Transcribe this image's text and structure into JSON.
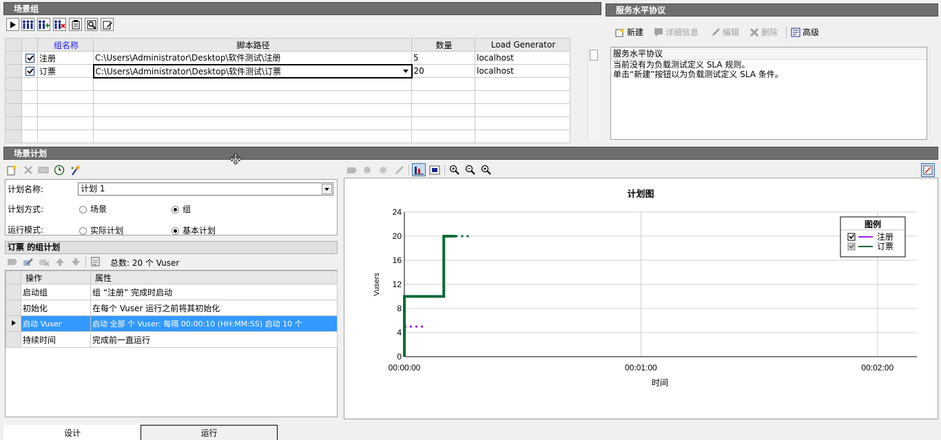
{
  "scenario_group": {
    "title": "场景组",
    "columns": [
      "组名称",
      "脚本路径",
      "数量",
      "Load Generator"
    ],
    "rows": [
      {
        "name": "注册",
        "path": "C:\\Users\\Administrator\\Desktop\\软件测试\\注册",
        "qty": "5",
        "lg": "localhost"
      },
      {
        "name": "订票",
        "path": "C:\\Users\\Administrator\\Desktop\\软件测试\\订票",
        "qty": "20",
        "lg": "localhost"
      }
    ]
  },
  "sla": {
    "title": "服务水平协议",
    "buttons": {
      "new": "新建",
      "details": "详细信息",
      "edit": "编辑",
      "delete": "删除",
      "advanced": "高级"
    },
    "box_header": "服务水平协议",
    "line1": "当前没有为负载测试定义 SLA 规则。",
    "line2": "单击“新建”按钮以为负载测试定义 SLA 条件。"
  },
  "schedule": {
    "title": "场景计划",
    "name_label": "计划名称:",
    "name_value": "计划 1",
    "mode_label": "计划方式:",
    "mode_scenario": "场景",
    "mode_group": "组",
    "run_label": "运行模式:",
    "run_real": "实际计划",
    "run_basic": "基本计划"
  },
  "group_plan": {
    "title": "订票 的组计划",
    "total": "总数: 20 个 Vuser",
    "columns": [
      "操作",
      "属性"
    ],
    "rows": [
      {
        "action": "启动组",
        "prop": "组 “注册” 完成时启动"
      },
      {
        "action": "初始化",
        "prop": "在每个 Vuser 运行之前将其初始化"
      },
      {
        "action": "启动 Vuser",
        "prop": "启动 全部 个 Vuser: 每隔 00:00:10 (HH:MM:SS) 启动 10 个"
      },
      {
        "action": "持续时间",
        "prop": "完成前一直运行"
      }
    ]
  },
  "chart_data": {
    "type": "line",
    "title": "计划图",
    "xlabel": "时间",
    "ylabel": "Vusers",
    "xlim": [
      0,
      130
    ],
    "ylim": [
      0,
      24
    ],
    "yticks": [
      0,
      4,
      8,
      12,
      16,
      20,
      24
    ],
    "xticks": [
      {
        "v": 0,
        "label": "00:00:00"
      },
      {
        "v": 60,
        "label": "00:01:00"
      },
      {
        "v": 120,
        "label": "00:02:00"
      }
    ],
    "legend_title": "图例",
    "legend_position": "top-right",
    "series": [
      {
        "name": "注册",
        "color": "#a020f0",
        "style": "dotted",
        "x": [
          0,
          5
        ],
        "y": [
          5,
          5
        ]
      },
      {
        "name": "订票",
        "color": "#0a6a36",
        "style": "solid",
        "x": [
          0,
          0,
          10,
          10,
          13
        ],
        "y": [
          0,
          10,
          10,
          20,
          20
        ]
      }
    ]
  },
  "tabs": {
    "design": "设计",
    "run": "运行"
  },
  "colors": {
    "selection": "#3399ff",
    "panel_title": "#6e6e6e",
    "series_booking": "#0a6a36",
    "series_register": "#a020f0"
  }
}
